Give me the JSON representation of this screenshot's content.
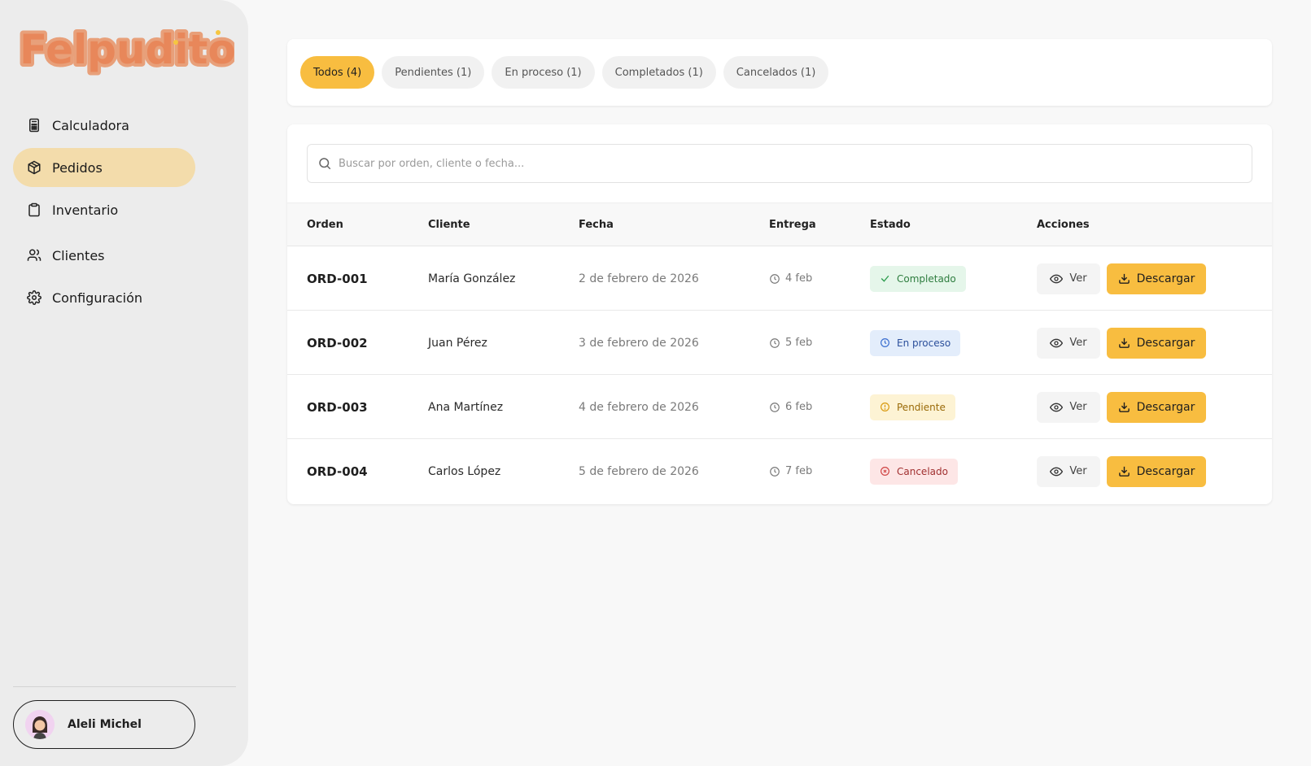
{
  "brand": {
    "logo_text": "Felpuditos"
  },
  "sidebar": {
    "items": [
      {
        "label": "Calculadora",
        "icon": "calculator-icon"
      },
      {
        "label": "Pedidos",
        "icon": "package-icon",
        "active": true
      },
      {
        "label": "Inventario",
        "icon": "clipboard-icon"
      },
      {
        "label": "Clientes",
        "icon": "users-icon"
      },
      {
        "label": "Configuración",
        "icon": "gear-icon"
      }
    ],
    "user": {
      "name": "Aleli Michel"
    }
  },
  "filters": [
    {
      "label": "Todos (4)",
      "active": true
    },
    {
      "label": "Pendientes (1)"
    },
    {
      "label": "En proceso (1)"
    },
    {
      "label": "Completados (1)"
    },
    {
      "label": "Cancelados (1)"
    }
  ],
  "search": {
    "placeholder": "Buscar por orden, cliente o fecha..."
  },
  "table": {
    "headers": {
      "orden": "Orden",
      "cliente": "Cliente",
      "fecha": "Fecha",
      "entrega": "Entrega",
      "estado": "Estado",
      "acciones": "Acciones"
    },
    "rows": [
      {
        "orden": "ORD-001",
        "cliente": "María González",
        "fecha": "2 de febrero de 2026",
        "entrega": "4 feb",
        "estado": "Completado"
      },
      {
        "orden": "ORD-002",
        "cliente": "Juan Pérez",
        "fecha": "3 de febrero de 2026",
        "entrega": "5 feb",
        "estado": "En proceso"
      },
      {
        "orden": "ORD-003",
        "cliente": "Ana Martínez",
        "fecha": "4 de febrero de 2026",
        "entrega": "6 feb",
        "estado": "Pendiente"
      },
      {
        "orden": "ORD-004",
        "cliente": "Carlos López",
        "fecha": "5 de febrero de 2026",
        "entrega": "7 feb",
        "estado": "Cancelado"
      }
    ],
    "actions": {
      "view_label": "Ver",
      "download_label": "Descargar"
    }
  },
  "colors": {
    "accent": "#f8bd40",
    "active_nav": "#f3dcab"
  }
}
